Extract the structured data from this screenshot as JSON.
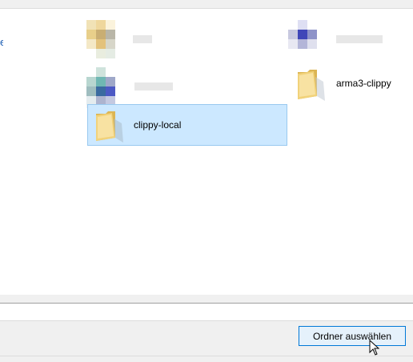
{
  "items": {
    "blurred_1": {
      "label": ""
    },
    "blurred_2": {
      "label": ""
    },
    "blurred_3": {
      "label": ""
    },
    "arma3": {
      "label": "arma3-clippy",
      "icon": "folder-icon"
    },
    "clippy_local": {
      "label": "clippy-local",
      "icon": "folder-icon",
      "selected": true
    }
  },
  "nav": {
    "partial_text": "e"
  },
  "buttons": {
    "select_folder": "Ordner auswählen"
  },
  "colors": {
    "selection_bg": "#cce8ff",
    "selection_border": "#99c9ef",
    "button_border": "#0078d7",
    "folder_yellow": "#f5d77e",
    "folder_dark": "#dcb553"
  }
}
